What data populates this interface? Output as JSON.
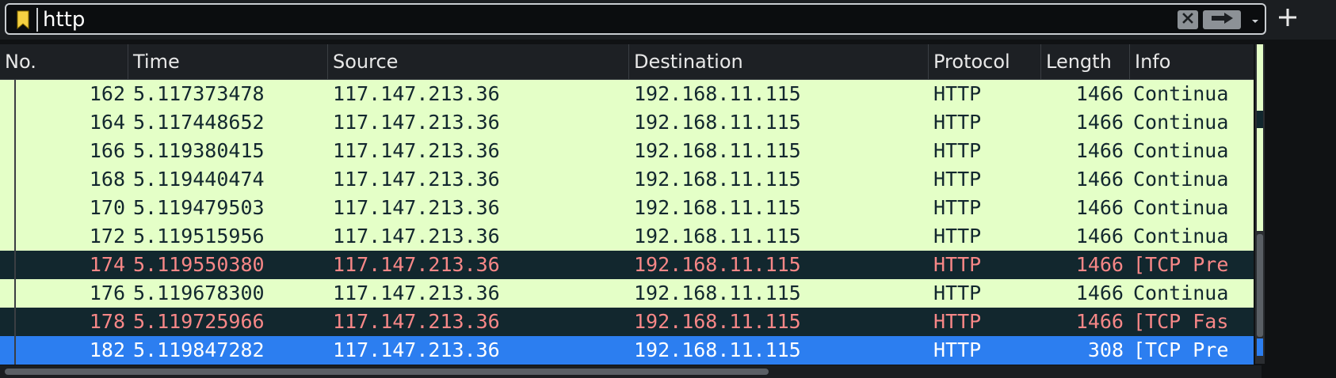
{
  "filter": {
    "value": "http",
    "icons": {
      "bookmark": "bookmark-icon",
      "clear": "clear-x-icon",
      "apply": "arrow-right-icon",
      "dropdown": "chevron-down-icon",
      "add": "plus-icon"
    },
    "colors": {
      "bookmark": "#f5d142"
    }
  },
  "packet_list": {
    "columns": [
      "No.",
      "Time",
      "Source",
      "Destination",
      "Protocol",
      "Length",
      "Info"
    ],
    "rows": [
      {
        "no": "162",
        "time": "5.117373478",
        "source": "117.147.213.36",
        "destination": "192.168.11.115",
        "protocol": "HTTP",
        "length": "1466",
        "info": "Continua",
        "style": "normal"
      },
      {
        "no": "164",
        "time": "5.117448652",
        "source": "117.147.213.36",
        "destination": "192.168.11.115",
        "protocol": "HTTP",
        "length": "1466",
        "info": "Continua",
        "style": "normal"
      },
      {
        "no": "166",
        "time": "5.119380415",
        "source": "117.147.213.36",
        "destination": "192.168.11.115",
        "protocol": "HTTP",
        "length": "1466",
        "info": "Continua",
        "style": "normal"
      },
      {
        "no": "168",
        "time": "5.119440474",
        "source": "117.147.213.36",
        "destination": "192.168.11.115",
        "protocol": "HTTP",
        "length": "1466",
        "info": "Continua",
        "style": "normal"
      },
      {
        "no": "170",
        "time": "5.119479503",
        "source": "117.147.213.36",
        "destination": "192.168.11.115",
        "protocol": "HTTP",
        "length": "1466",
        "info": "Continua",
        "style": "normal"
      },
      {
        "no": "172",
        "time": "5.119515956",
        "source": "117.147.213.36",
        "destination": "192.168.11.115",
        "protocol": "HTTP",
        "length": "1466",
        "info": "Continua",
        "style": "normal"
      },
      {
        "no": "174",
        "time": "5.119550380",
        "source": "117.147.213.36",
        "destination": "192.168.11.115",
        "protocol": "HTTP",
        "length": "1466",
        "info": "[TCP Pre",
        "style": "warn"
      },
      {
        "no": "176",
        "time": "5.119678300",
        "source": "117.147.213.36",
        "destination": "192.168.11.115",
        "protocol": "HTTP",
        "length": "1466",
        "info": "Continua",
        "style": "normal"
      },
      {
        "no": "178",
        "time": "5.119725966",
        "source": "117.147.213.36",
        "destination": "192.168.11.115",
        "protocol": "HTTP",
        "length": "1466",
        "info": "[TCP Fas",
        "style": "warn"
      },
      {
        "no": "182",
        "time": "5.119847282",
        "source": "117.147.213.36",
        "destination": "192.168.11.115",
        "protocol": "HTTP",
        "length": "308",
        "info": "[TCP Pre",
        "style": "selected"
      }
    ],
    "colors": {
      "normal_bg": "#e4ffc7",
      "normal_fg": "#12272e",
      "warn_bg": "#12272e",
      "warn_fg": "#f78787",
      "selected_bg": "#2c7ef0",
      "selected_fg": "#ffffff"
    }
  }
}
